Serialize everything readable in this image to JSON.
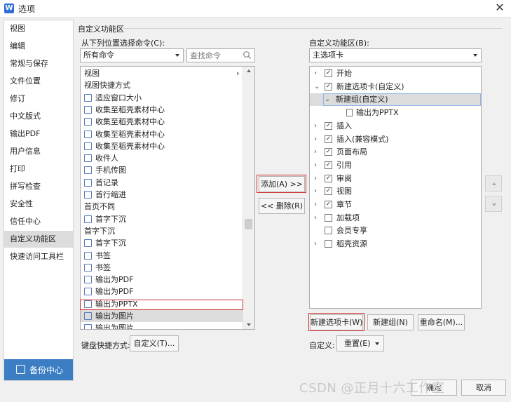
{
  "window": {
    "title": "选项",
    "app_icon_letter": "W",
    "close_glyph": "✕"
  },
  "nav": {
    "items": [
      "视图",
      "编辑",
      "常规与保存",
      "文件位置",
      "修订",
      "中文版式",
      "输出PDF",
      "用户信息",
      "打印",
      "拼写检查",
      "安全性",
      "信任中心",
      "自定义功能区",
      "快速访问工具栏"
    ],
    "active": "自定义功能区",
    "backup_label": "备份中心"
  },
  "section_title": "自定义功能区",
  "left": {
    "choose_label": "从下列位置选择命令(C):",
    "source_value": "所有命令",
    "search_placeholder": "查找命令",
    "commands": [
      {
        "text": "视图",
        "icon": false,
        "more": "›"
      },
      {
        "text": "视图快捷方式",
        "icon": false
      },
      {
        "text": "适应窗口大小",
        "icon": true
      },
      {
        "text": "收集至稻壳素材中心",
        "icon": true
      },
      {
        "text": "收集至稻壳素材中心",
        "icon": true
      },
      {
        "text": "收集至稻壳素材中心",
        "icon": true
      },
      {
        "text": "收集至稻壳素材中心",
        "icon": true
      },
      {
        "text": "收件人",
        "icon": true
      },
      {
        "text": "手机传图",
        "icon": true
      },
      {
        "text": "首记录",
        "icon": true
      },
      {
        "text": "首行缩进",
        "icon": true
      },
      {
        "text": "首页不同",
        "icon": false
      },
      {
        "text": "首字下沉",
        "icon": true
      },
      {
        "text": "首字下沉",
        "icon": false
      },
      {
        "text": "首字下沉",
        "icon": true
      },
      {
        "text": "书签",
        "icon": true
      },
      {
        "text": "书签",
        "icon": true
      },
      {
        "text": "输出为PDF",
        "icon": true
      },
      {
        "text": "输出为PDF",
        "icon": true
      },
      {
        "text": "输出为PPTX",
        "icon": true
      },
      {
        "text": "输出为图片",
        "icon": true,
        "selected": true
      },
      {
        "text": "输出为图片",
        "icon": true
      }
    ],
    "shortcut_label": "键盘快捷方式:",
    "customize_btn": "自定义(T)..."
  },
  "middle": {
    "add_btn": "添加(A) >>",
    "remove_btn": "<< 删除(R)"
  },
  "right": {
    "ribbon_label": "自定义功能区(B):",
    "tabs_value": "主选项卡",
    "tree": [
      {
        "text": "开始",
        "level": 0,
        "expand": "›",
        "checked": true
      },
      {
        "text": "新建选项卡(自定义)",
        "level": 0,
        "expand": "⌄",
        "checked": true
      },
      {
        "text": "新建组(自定义)",
        "level": 1,
        "expand": "⌄",
        "nocheck": true,
        "highlight": true
      },
      {
        "text": "输出为PPTX",
        "level": 2,
        "expand": "",
        "nocheck": true,
        "icon": true
      },
      {
        "text": "插入",
        "level": 0,
        "expand": "›",
        "checked": true
      },
      {
        "text": "插入(兼容模式)",
        "level": 0,
        "expand": "›",
        "checked": true
      },
      {
        "text": "页面布局",
        "level": 0,
        "expand": "›",
        "checked": true
      },
      {
        "text": "引用",
        "level": 0,
        "expand": "›",
        "checked": true
      },
      {
        "text": "审阅",
        "level": 0,
        "expand": "›",
        "checked": true
      },
      {
        "text": "视图",
        "level": 0,
        "expand": "›",
        "checked": true
      },
      {
        "text": "章节",
        "level": 0,
        "expand": "›",
        "checked": true
      },
      {
        "text": "加载项",
        "level": 0,
        "expand": "›",
        "checked": false
      },
      {
        "text": "会员专享",
        "level": 0,
        "expand": "",
        "checked": false
      },
      {
        "text": "稻壳资源",
        "level": 0,
        "expand": "›",
        "checked": false
      }
    ],
    "new_tab_btn": "新建选项卡(W)",
    "new_group_btn": "新建组(N)",
    "rename_btn": "重命名(M)...",
    "customize_label": "自定义:",
    "reset_btn": "重置(E)"
  },
  "footer": {
    "ok_btn": "确定",
    "cancel_btn": "取消"
  },
  "watermark": "CSDN @正月十六工作室",
  "colors": {
    "accent": "#3c7ec4",
    "highlight_border": "#d32f2f",
    "selection": "#dcdcdc"
  }
}
